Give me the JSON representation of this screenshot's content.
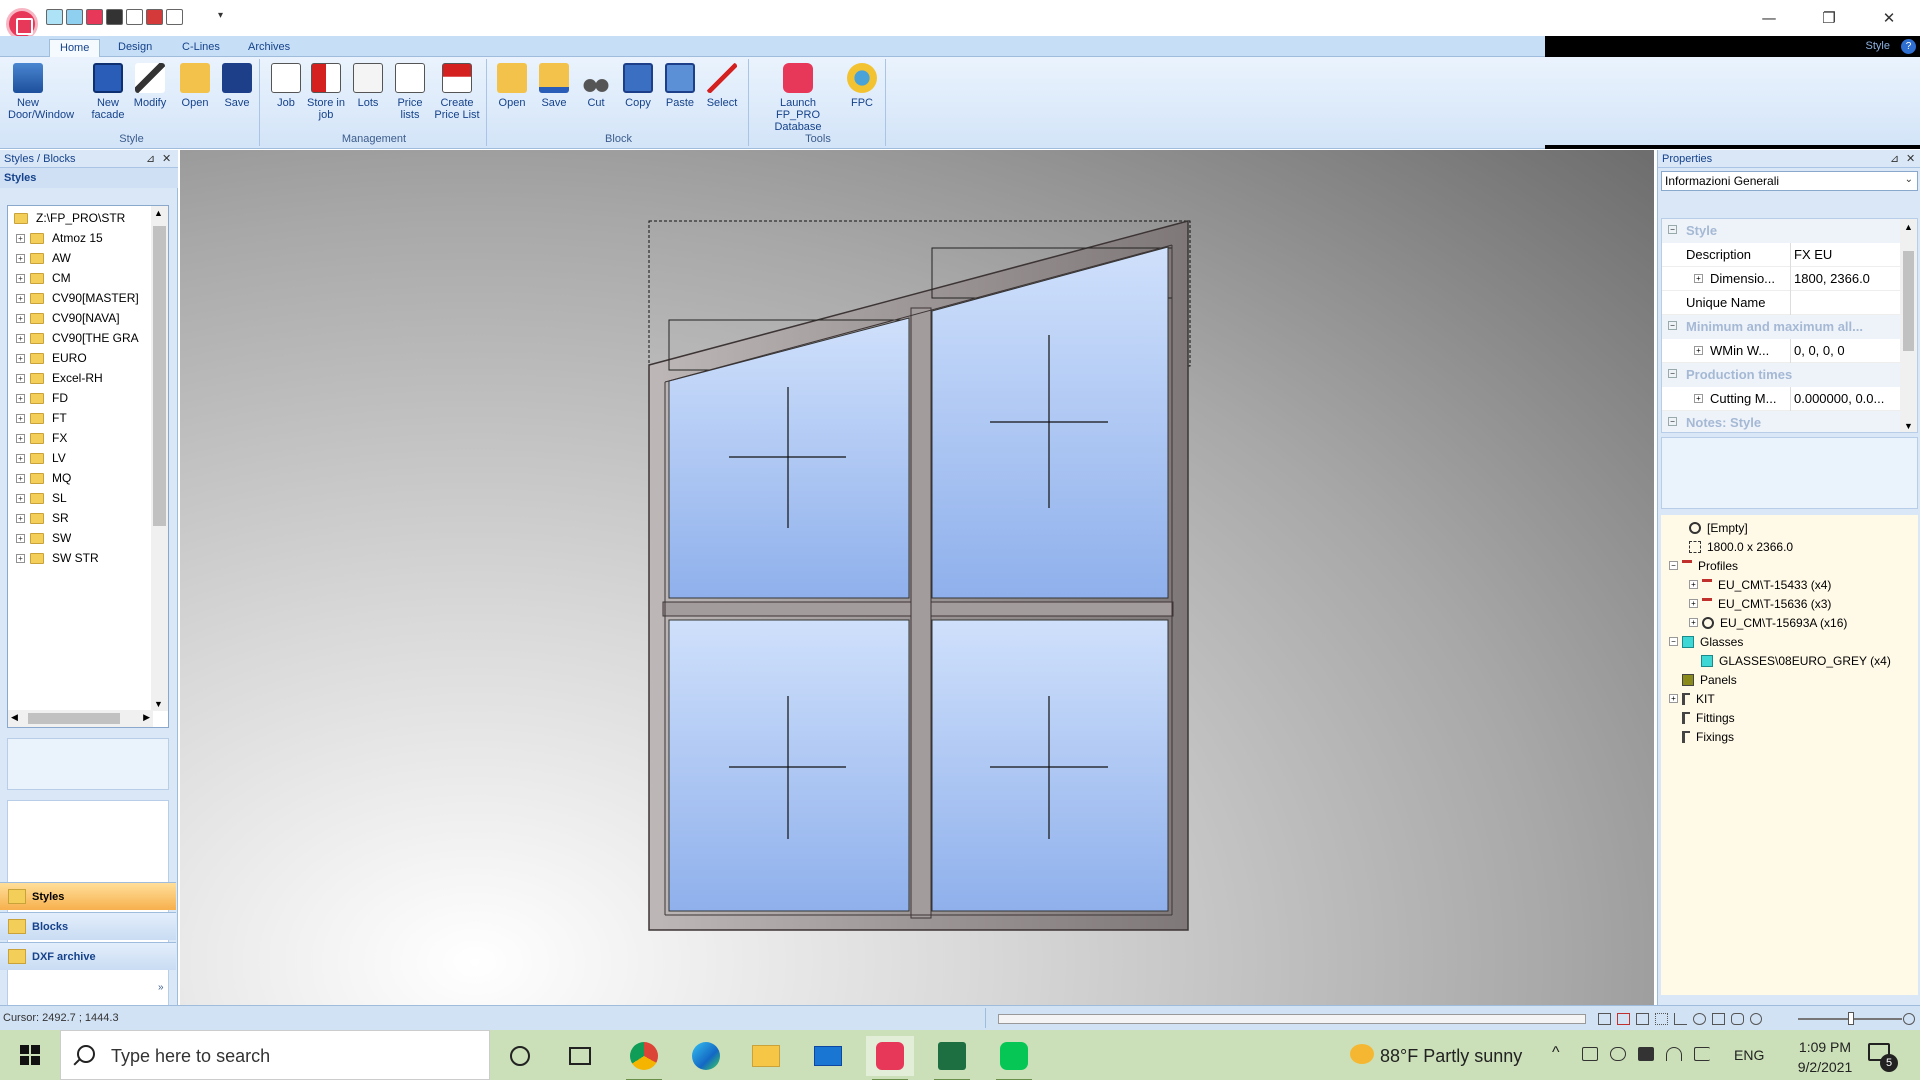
{
  "ribbon": {
    "tabs": [
      "Home",
      "Design",
      "C-Lines",
      "Archives"
    ],
    "style_label": "Style",
    "groups": {
      "style": {
        "label": "Style",
        "buttons": [
          "New Door/Window",
          "New facade",
          "Modify",
          "Open",
          "Save"
        ]
      },
      "management": {
        "label": "Management",
        "buttons": [
          "Job",
          "Store in job",
          "Lots",
          "Price lists",
          "Create Price List"
        ]
      },
      "block": {
        "label": "Block",
        "buttons": [
          "Open",
          "Save",
          "Cut",
          "Copy",
          "Paste",
          "Select"
        ]
      },
      "tools": {
        "label": "Tools",
        "buttons": [
          "Launch FP_PRO Database",
          "FPC"
        ]
      }
    }
  },
  "left_panel": {
    "title": "Styles / Blocks",
    "subtitle": "Styles",
    "tree_root": "Z:\\FP_PRO\\STR",
    "tree_items": [
      "Atmoz 15",
      "AW",
      "CM",
      "CV90[MASTER]",
      "CV90[NAVA]",
      "CV90[THE GRA",
      "EURO",
      "Excel-RH",
      "FD",
      "FT",
      "FX",
      "LV",
      "MQ",
      "SL",
      "SR",
      "SW",
      "SW STR"
    ],
    "nav": [
      "Styles",
      "Blocks",
      "DXF archive"
    ]
  },
  "properties": {
    "title": "Properties",
    "selector": "Informazioni Generali",
    "categories": [
      "Style",
      "Minimum and maximum all...",
      "Production times",
      "Notes: Style"
    ],
    "rows": [
      {
        "name": "Description",
        "value": "FX EU"
      },
      {
        "name": "Dimensio...",
        "value": "1800, 2366.0"
      },
      {
        "name": "Unique Name",
        "value": ""
      },
      {
        "name": "WMin W...",
        "value": "0, 0, 0, 0"
      },
      {
        "name": "Cutting M...",
        "value": "0.000000, 0.0..."
      }
    ]
  },
  "component_tree": [
    "[Empty]",
    "1800.0 x 2366.0",
    "Profiles",
    "EU_CM\\T-15433 (x4)",
    "EU_CM\\T-15636 (x3)",
    "EU_CM\\T-15693A (x16)",
    "Glasses",
    "GLASSES\\08EURO_GREY (x4)",
    "Panels",
    "KIT",
    "Fittings",
    "Fixings"
  ],
  "status": {
    "cursor": "Cursor:  2492.7 ; 1444.3"
  },
  "taskbar": {
    "search_placeholder": "Type here to search",
    "weather": "88°F  Partly sunny",
    "lang": "ENG",
    "time": "1:09 PM",
    "date": "9/2/2021",
    "notifications": "5"
  },
  "colors": {
    "ribbon_bg": "#d3e4f8",
    "accent_orange": "#f7b04d",
    "taskbar": "#cbe0b8",
    "glass": "#a7c4f0",
    "frame": "#a8a2a2"
  }
}
